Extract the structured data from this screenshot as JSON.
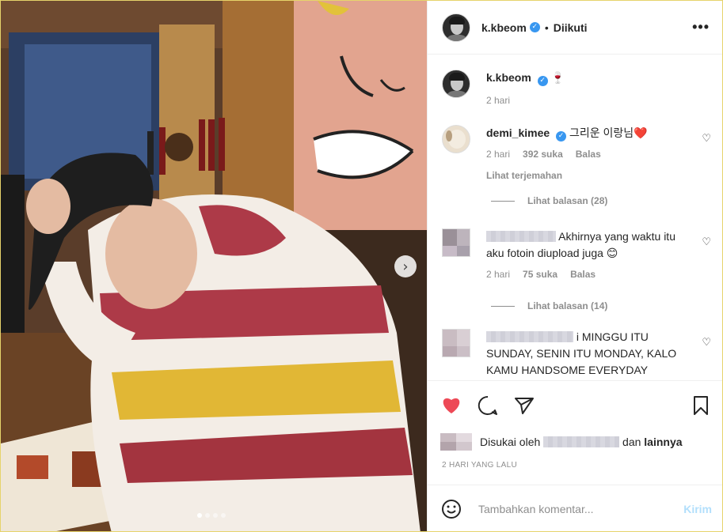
{
  "post": {
    "username": "k.kbeom",
    "follow_status": "Diikuti",
    "more_label": "•••",
    "caption_emoji": "🍷",
    "caption_time": "2 hari"
  },
  "comments": [
    {
      "username": "demi_kimee",
      "verified": true,
      "text": "그리운 이랑님❤️",
      "time": "2 hari",
      "likes": "392 suka",
      "reply": "Balas",
      "translate": "Lihat terjemahan",
      "view_replies": "Lihat balasan (28)"
    },
    {
      "username_redacted": true,
      "text": "Akhirnya yang waktu itu aku fotoin diupload juga 😊",
      "time": "2 hari",
      "likes": "75 suka",
      "reply": "Balas",
      "view_replies": "Lihat balasan (14)"
    },
    {
      "username_redacted": true,
      "text": "i MINGGU ITU SUNDAY, SENIN ITU MONDAY, KALO KAMU HANDSOME EVERYDAY"
    }
  ],
  "actions": {
    "liked_by_prefix": "Disukai oleh",
    "liked_by_and": "dan",
    "liked_by_others": "lainnya",
    "timestamp": "2 HARI YANG LALU",
    "comment_placeholder": "Tambahkan komentar...",
    "post_button": "Kirim"
  },
  "carousel": {
    "next_icon": "chevron-right-icon",
    "slides": 4,
    "active": 1
  },
  "colors": {
    "like_red": "#ed4956",
    "verified_blue": "#3897f0",
    "post_button_disabled": "#b2dffc",
    "meta_gray": "#8e8e8e"
  }
}
